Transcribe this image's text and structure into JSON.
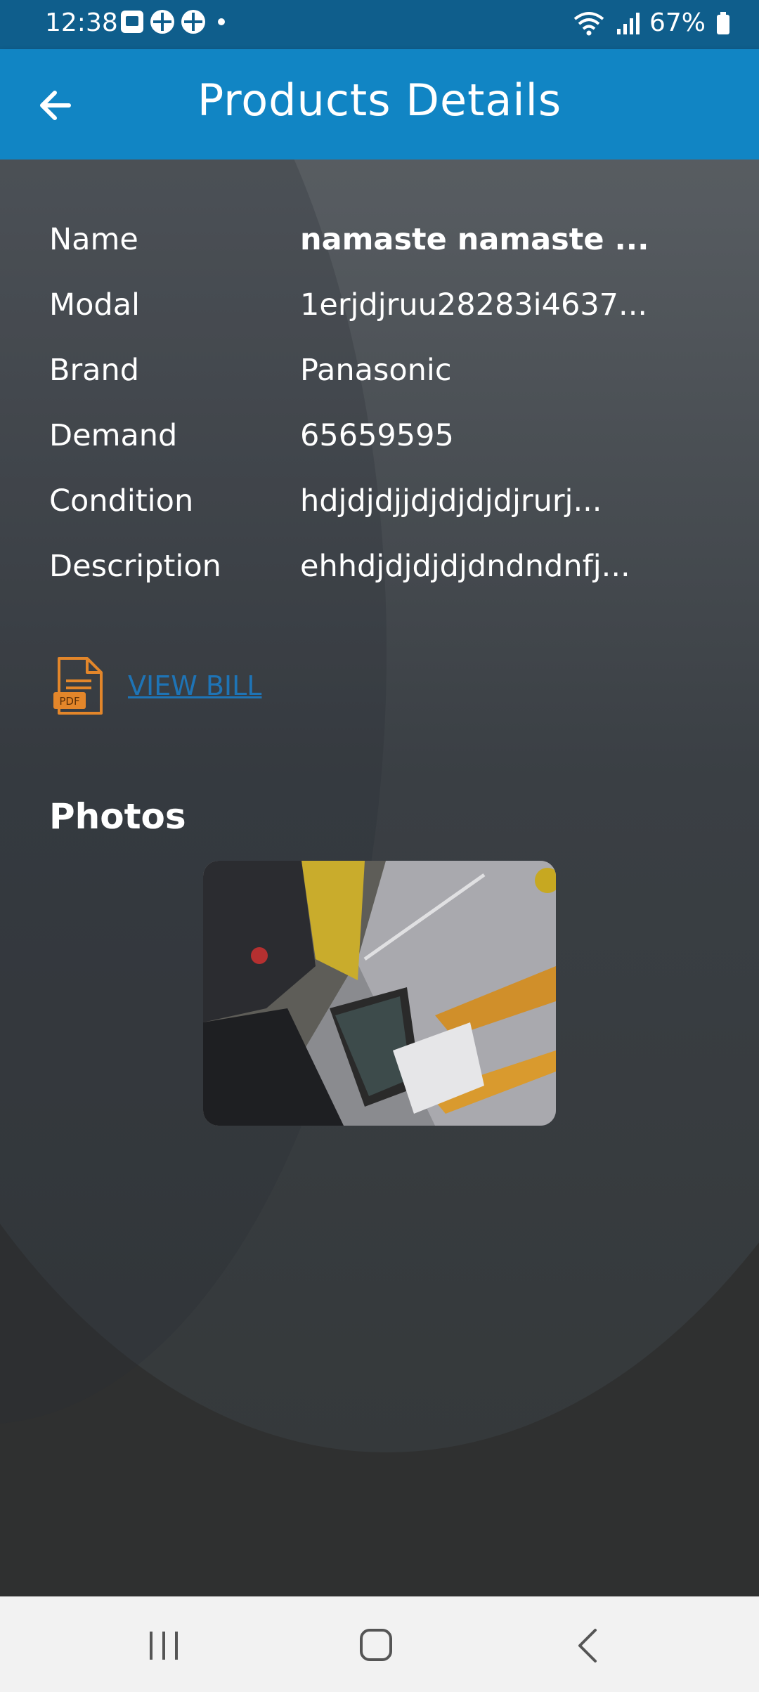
{
  "status_bar": {
    "time": "12:38",
    "battery": "67%",
    "icons": [
      "gallery-icon",
      "clover-icon",
      "clover-icon",
      "dot-icon",
      "wifi-icon",
      "signal-icon",
      "battery-icon"
    ]
  },
  "app_bar": {
    "title": "Products Details",
    "back_icon": "arrow-left-icon"
  },
  "details": [
    {
      "label": "Name",
      "value": "namaste namaste ..."
    },
    {
      "label": "Modal",
      "value": "1erjdjruu28283i4637..."
    },
    {
      "label": "Brand",
      "value": "Panasonic"
    },
    {
      "label": "Demand",
      "value": "65659595"
    },
    {
      "label": "Condition",
      "value": "hdjdjdjjdjdjdjdjrurj..."
    },
    {
      "label": "Description",
      "value": "ehhdjdjdjdjdndndnfj..."
    }
  ],
  "bill": {
    "icon_label": "PDF",
    "link_text": "VIEW BILL"
  },
  "photos": {
    "heading": "Photos"
  },
  "colors": {
    "status_bar": "#0f5e8c",
    "app_bar": "#1185c4",
    "link": "#1e74b6",
    "pdf_icon": "#e3862a",
    "nav_bar": "#f2f2f2"
  },
  "nav_bar": {
    "icons": [
      "recents-icon",
      "home-icon",
      "back-icon"
    ]
  }
}
